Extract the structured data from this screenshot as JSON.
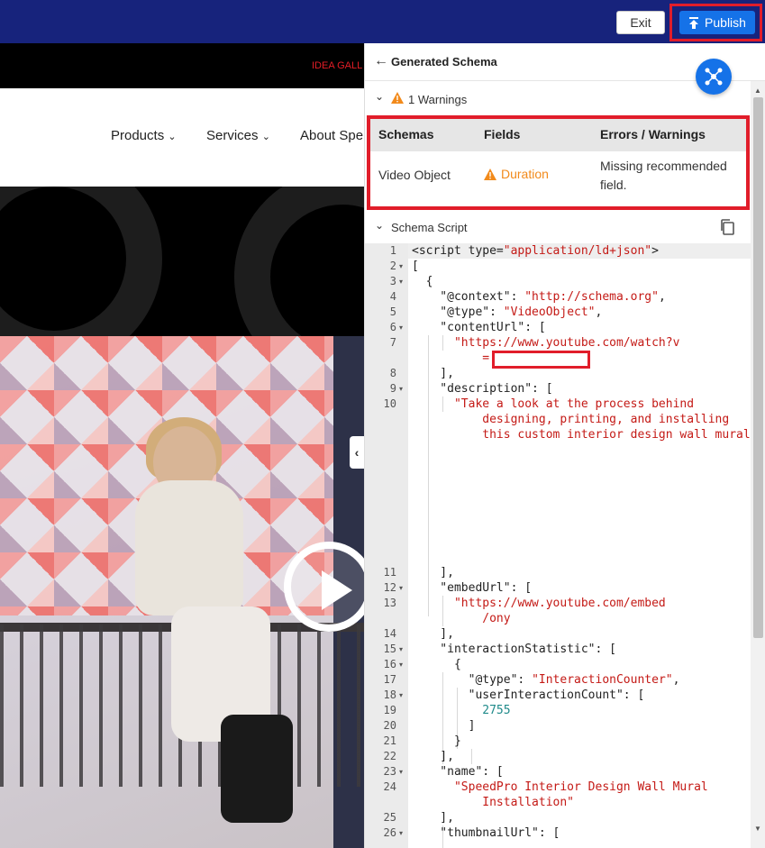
{
  "topbar": {
    "exit_label": "Exit",
    "publish_label": "Publish"
  },
  "site": {
    "announce_text": "IDEA GALL",
    "nav": [
      {
        "label": "Products"
      },
      {
        "label": "Services"
      },
      {
        "label": "About Spe"
      }
    ]
  },
  "panel": {
    "title": "Generated Schema",
    "warnings_label": "1 Warnings",
    "table": {
      "headers": [
        "Schemas",
        "Fields",
        "Errors / Warnings"
      ],
      "rows": [
        {
          "schema": "Video Object",
          "field": "Duration",
          "message_line1": "Missing recommended",
          "message_line2": "field."
        }
      ]
    },
    "script_label": "Schema Script",
    "code_lines": [
      {
        "n": "1",
        "fold": false
      },
      {
        "n": "2",
        "fold": true
      },
      {
        "n": "3",
        "fold": true
      },
      {
        "n": "4",
        "fold": false
      },
      {
        "n": "5",
        "fold": false
      },
      {
        "n": "6",
        "fold": true
      },
      {
        "n": "7",
        "fold": false
      },
      {
        "n": "8",
        "fold": false
      },
      {
        "n": "9",
        "fold": true
      },
      {
        "n": "10",
        "fold": false
      },
      {
        "n": "11",
        "fold": false
      },
      {
        "n": "12",
        "fold": true
      },
      {
        "n": "13",
        "fold": false
      },
      {
        "n": "14",
        "fold": false
      },
      {
        "n": "15",
        "fold": true
      },
      {
        "n": "16",
        "fold": true
      },
      {
        "n": "17",
        "fold": false
      },
      {
        "n": "18",
        "fold": true
      },
      {
        "n": "19",
        "fold": false
      },
      {
        "n": "20",
        "fold": false
      },
      {
        "n": "21",
        "fold": false
      },
      {
        "n": "22",
        "fold": false
      },
      {
        "n": "23",
        "fold": true
      },
      {
        "n": "24",
        "fold": false
      },
      {
        "n": "25",
        "fold": false
      },
      {
        "n": "26",
        "fold": true
      }
    ],
    "code": {
      "l1_a": "<script type=",
      "l1_b": "\"application/ld+json\"",
      "l1_c": ">",
      "l2": "[",
      "l3": "  {",
      "l4_k": "    \"@context\": ",
      "l4_v": "\"http://schema.org\"",
      "l4_e": ",",
      "l5_k": "    \"@type\": ",
      "l5_v": "\"VideoObject\"",
      "l5_e": ",",
      "l6": "    \"contentUrl\": [",
      "l7a": "      \"https://www.youtube.com/watch?v",
      "l7b": "          =",
      "l8": "    ],",
      "l9": "    \"description\": [",
      "l10a": "      \"Take a look at the process behind",
      "l10b": "          designing, printing, and installing",
      "l10c": "          this custom interior design wall mural",
      "l11": "    ],",
      "l12": "    \"embedUrl\": [",
      "l13a": "      \"https://www.youtube.com/embed",
      "l13b": "          /ony",
      "l14": "    ],",
      "l15": "    \"interactionStatistic\": [",
      "l16": "      {",
      "l17_k": "        \"@type\": ",
      "l17_v": "\"InteractionCounter\"",
      "l17_e": ",",
      "l18": "        \"userInteractionCount\": [",
      "l19": "          2755",
      "l20": "        ]",
      "l21": "      }",
      "l22": "    ],",
      "l23": "    \"name\": [",
      "l24a": "      \"SpeedPro Interior Design Wall Mural",
      "l24b": "          Installation\"",
      "l25": "    ],",
      "l26": "    \"thumbnailUrl\": ["
    }
  },
  "colors": {
    "topbar": "#17237c",
    "publish": "#1572e8",
    "highlight": "#e11d2a",
    "warning": "#f28a1b",
    "string": "#c41a16",
    "number": "#1f8a8a"
  },
  "icons": [
    "publish-upload-icon",
    "back-arrow-icon",
    "schema-network-icon",
    "chevron-down-icon",
    "warning-triangle-icon",
    "copy-icon",
    "play-icon"
  ]
}
